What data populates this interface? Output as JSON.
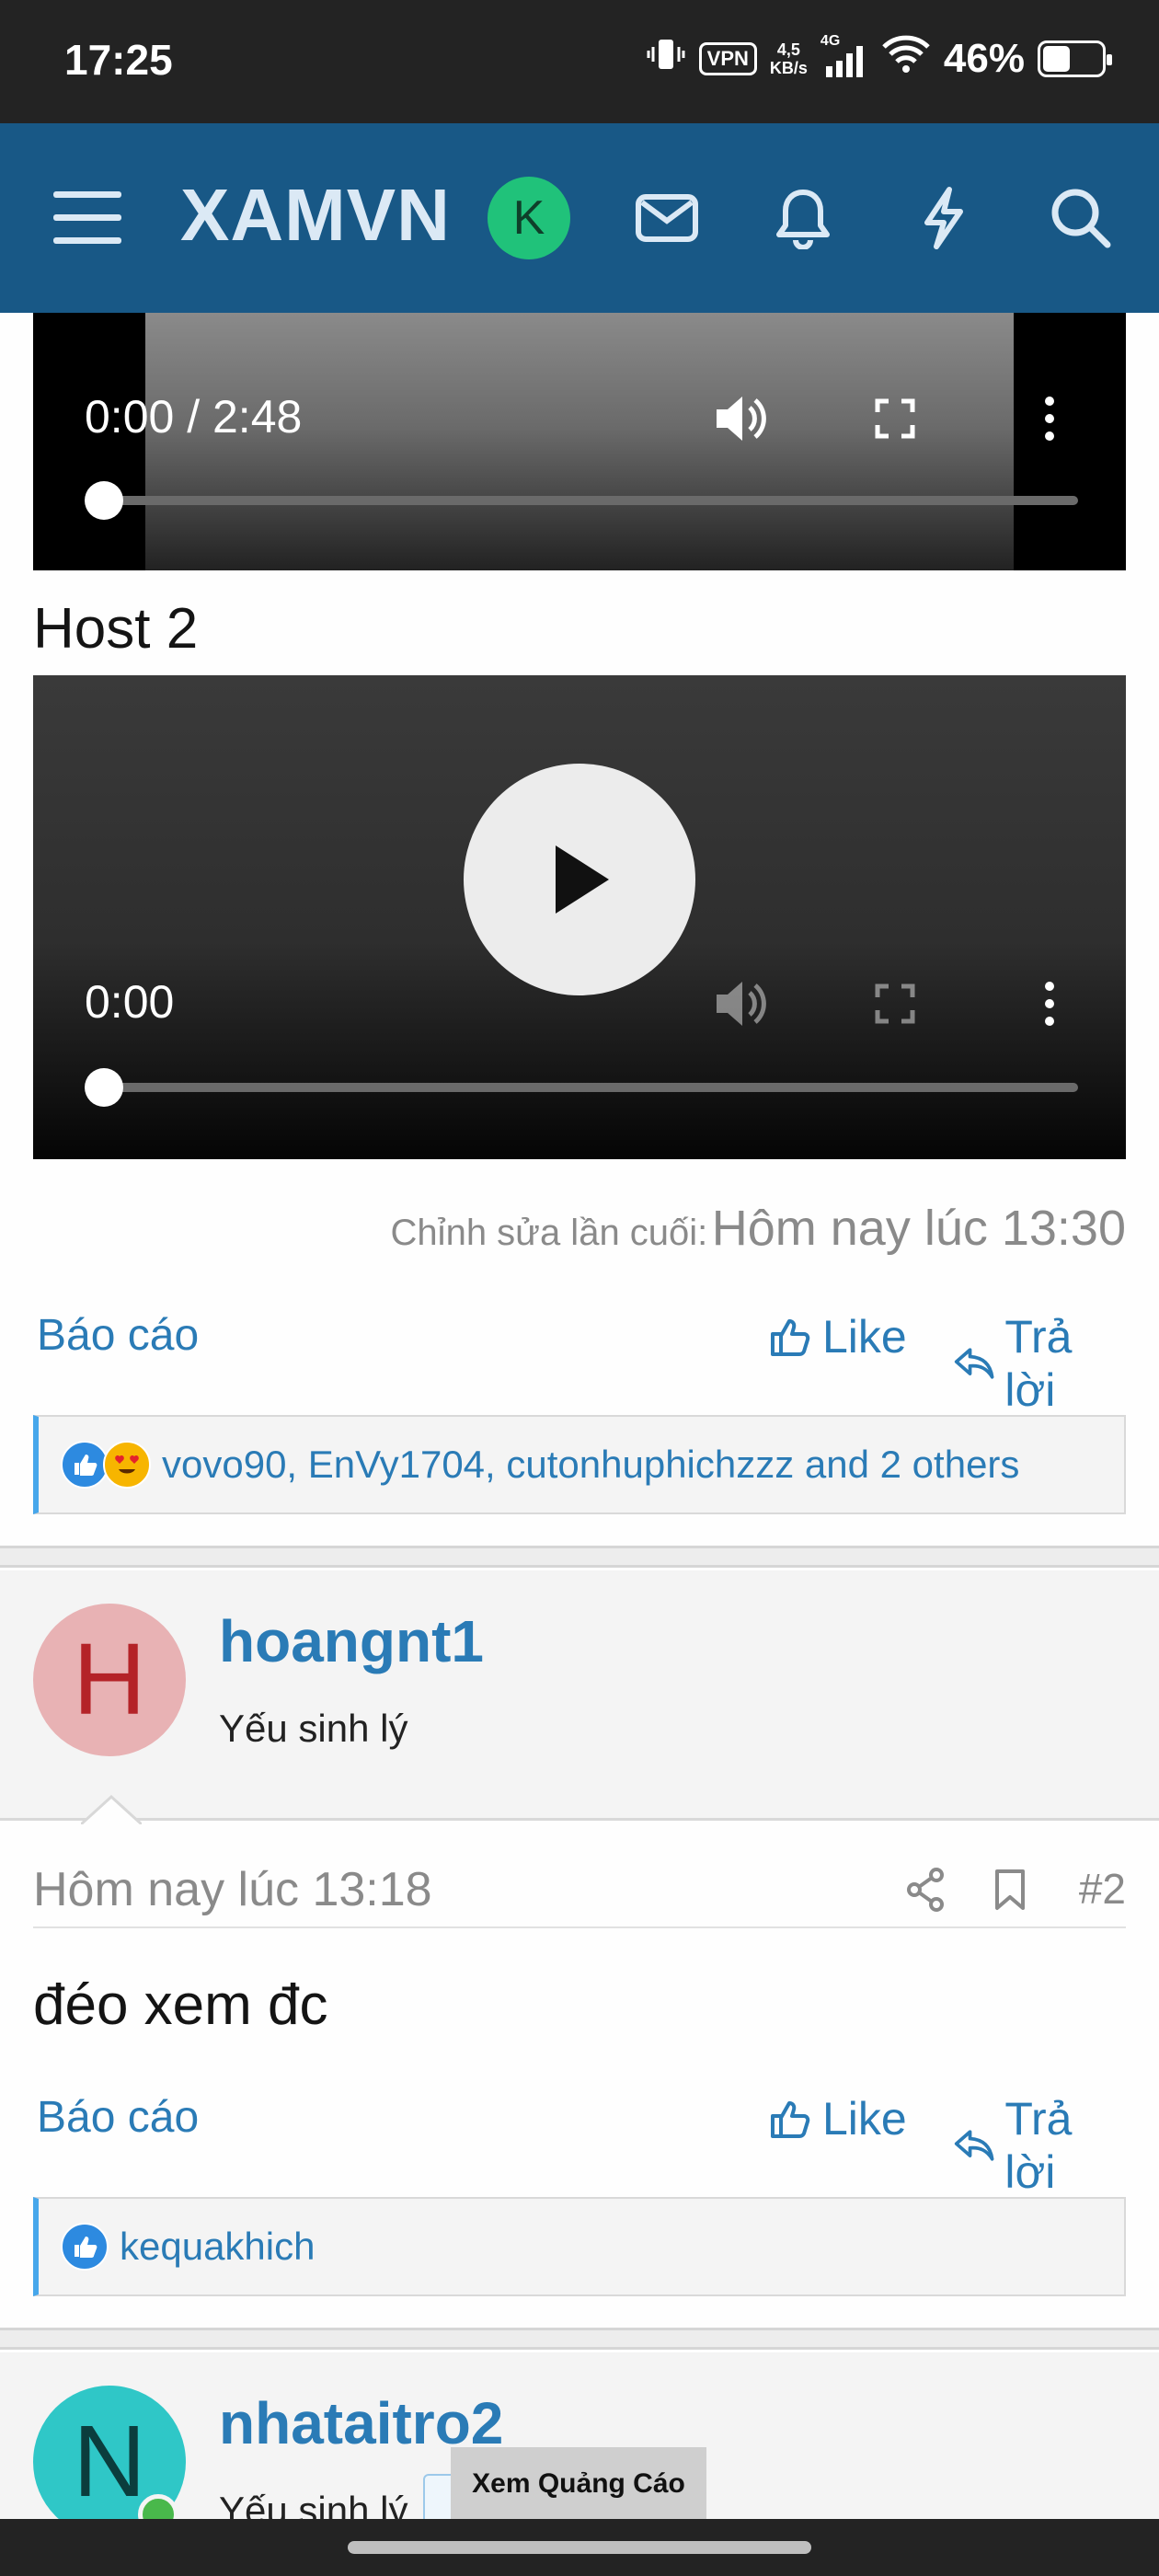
{
  "status_bar": {
    "time": "17:25",
    "vpn": "VPN",
    "net_speed_top": "4,5",
    "net_speed_bottom": "KB/s",
    "network": "4G",
    "battery": "46%",
    "battery_level_pct": 46
  },
  "header": {
    "logo": "XAMVN",
    "avatar_letter": "K",
    "icons": [
      "menu-icon",
      "mail-icon",
      "bell-icon",
      "bolt-icon",
      "search-icon"
    ],
    "colors": {
      "bar": "#185886",
      "avatar": "#20c27a"
    }
  },
  "video1": {
    "time": "0:00 / 2:48",
    "progress_pct": 0
  },
  "host2": {
    "title": "Host 2",
    "video": {
      "time": "0:00",
      "progress_pct": 0
    }
  },
  "post1": {
    "edited_label": "Chỉnh sửa lần cuối:",
    "edited_value": "Hôm nay lúc 13:30",
    "report": "Báo cáo",
    "like": "Like",
    "reply": "Trả lời",
    "reactions": "vovo90, EnVy1704, cutonhuphichzzz and 2 others"
  },
  "post2": {
    "avatar_letter": "H",
    "username": "hoangnt1",
    "user_title": "Yếu sinh lý",
    "date": "Hôm nay lúc 13:18",
    "number": "#2",
    "body": "đéo xem đc",
    "report": "Báo cáo",
    "like": "Like",
    "reply": "Trả lời",
    "reactions": "kequakhich"
  },
  "post3": {
    "avatar_letter": "N",
    "username": "nhataitro2",
    "user_title": "Yếu sinh lý"
  },
  "ad_button": "Xem Quảng Cáo"
}
